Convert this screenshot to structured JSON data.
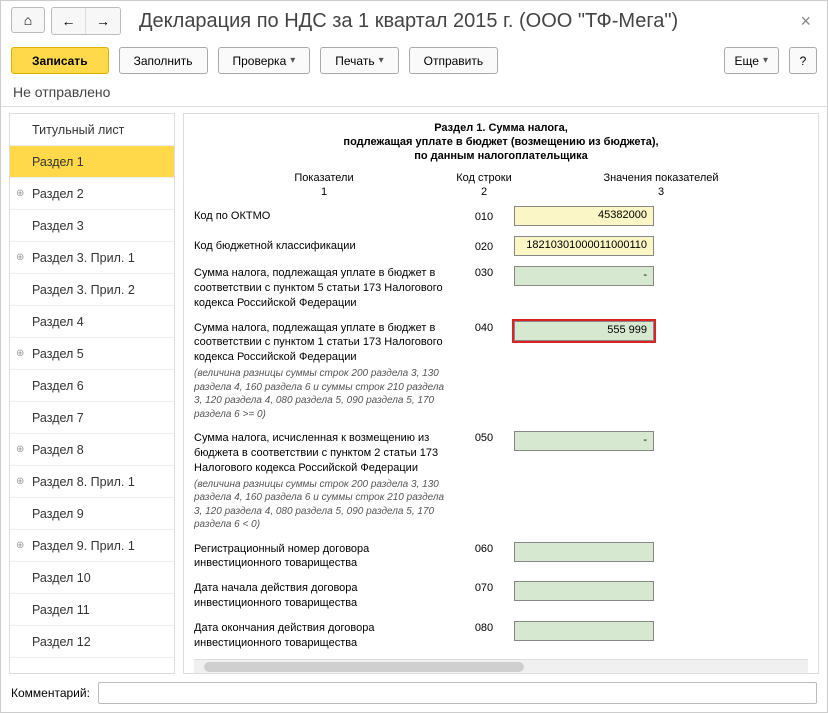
{
  "title": "Декларация по НДС за 1 квартал 2015 г. (ООО \"ТФ-Мега\")",
  "toolbar": {
    "save": "Записать",
    "fill": "Заполнить",
    "check": "Проверка",
    "print": "Печать",
    "send": "Отправить",
    "more": "Еще",
    "help": "?"
  },
  "status": "Не отправлено",
  "sidebar": [
    {
      "label": "Титульный лист",
      "expand": false
    },
    {
      "label": "Раздел 1",
      "expand": false,
      "active": true
    },
    {
      "label": "Раздел 2",
      "expand": true
    },
    {
      "label": "Раздел 3",
      "expand": false
    },
    {
      "label": "Раздел 3. Прил. 1",
      "expand": true
    },
    {
      "label": "Раздел 3. Прил. 2",
      "expand": false
    },
    {
      "label": "Раздел 4",
      "expand": false
    },
    {
      "label": "Раздел 5",
      "expand": true
    },
    {
      "label": "Раздел 6",
      "expand": false
    },
    {
      "label": "Раздел 7",
      "expand": false
    },
    {
      "label": "Раздел 8",
      "expand": true
    },
    {
      "label": "Раздел 8. Прил. 1",
      "expand": true
    },
    {
      "label": "Раздел 9",
      "expand": false
    },
    {
      "label": "Раздел 9. Прил. 1",
      "expand": true
    },
    {
      "label": "Раздел 10",
      "expand": false
    },
    {
      "label": "Раздел 11",
      "expand": false
    },
    {
      "label": "Раздел 12",
      "expand": false
    }
  ],
  "section": {
    "title1": "Раздел 1. Сумма налога,",
    "title2": "подлежащая уплате в бюджет (возмещению из бюджета),",
    "title3": "по данным налогоплательщика",
    "colh": {
      "c1": "Показатели",
      "c2": "Код строки",
      "c3": "Значения показателей"
    },
    "coln": {
      "c1": "1",
      "c2": "2",
      "c3": "3"
    },
    "rows": [
      {
        "label": "Код по ОКТМО",
        "code": "010",
        "value": "45382000",
        "style": "yellow"
      },
      {
        "label": "Код бюджетной классификации",
        "code": "020",
        "value": "18210301000011000110",
        "style": "yellow"
      },
      {
        "label": "Сумма налога, подлежащая уплате в бюджет в соответствии с пунктом 5 статьи 173 Налогового кодекса Российской Федерации",
        "code": "030",
        "value": "-",
        "style": "green"
      },
      {
        "label": "Сумма налога, подлежащая уплате в бюджет в соответствии с пунктом 1 статьи 173 Налогового кодекса Российской Федерации",
        "hint": "(величина разницы суммы строк 200 раздела 3, 130 раздела 4, 160 раздела 6 и суммы строк 210 раздела 3, 120 раздела 4, 080 раздела 5, 090 раздела 5, 170 раздела 6 >= 0)",
        "code": "040",
        "value": "555 999",
        "style": "green",
        "highlighted": true
      },
      {
        "label": "Сумма налога, исчисленная к возмещению из бюджета в соответствии с пунктом 2 статьи 173 Налогового кодекса Российской Федерации",
        "hint": "(величина разницы суммы строк 200 раздела 3, 130 раздела 4, 160 раздела 6 и суммы строк 210 раздела 3, 120 раздела 4, 080 раздела 5, 090 раздела 5, 170 раздела 6 < 0)",
        "code": "050",
        "value": "-",
        "style": "green"
      },
      {
        "label": "Регистрационный номер договора инвестиционного товарищества",
        "code": "060",
        "value": "",
        "style": "green"
      },
      {
        "label": "Дата начала действия договора инвестиционного товарищества",
        "code": "070",
        "value": "",
        "style": "green"
      },
      {
        "label": "Дата окончания действия договора инвестиционного товарищества",
        "code": "080",
        "value": "",
        "style": "green"
      }
    ]
  },
  "footer": {
    "label": "Комментарий:",
    "value": ""
  }
}
